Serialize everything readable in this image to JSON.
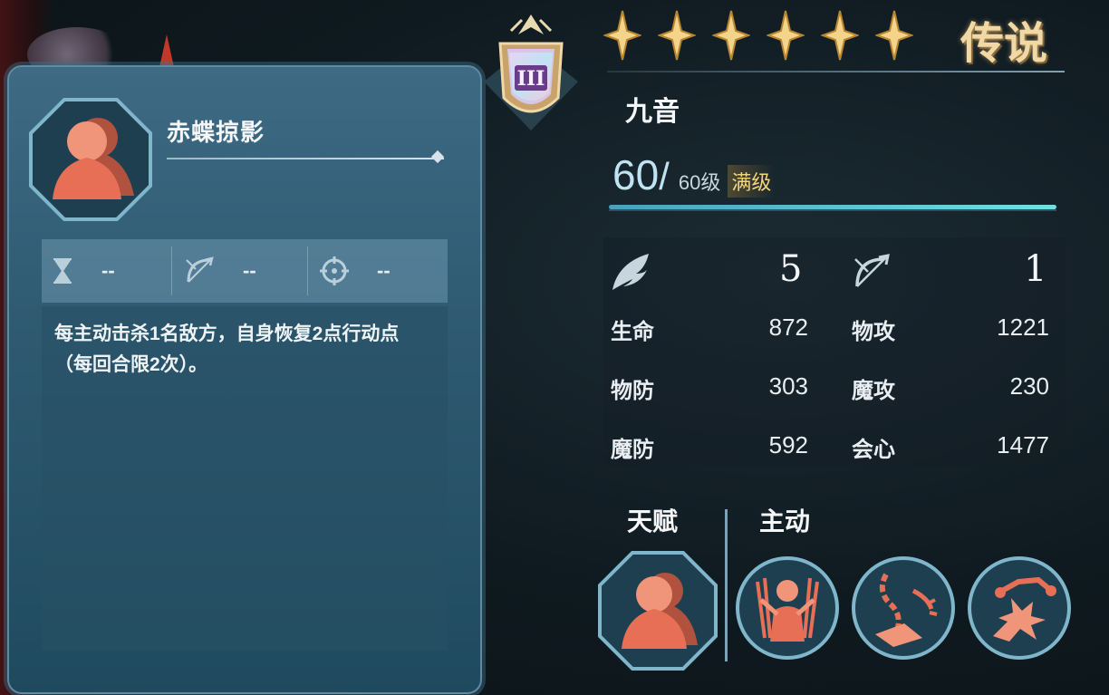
{
  "skill": {
    "name": "赤蝶掠影",
    "attrs": [
      {
        "icon": "hourglass-icon",
        "value": "--"
      },
      {
        "icon": "bow-range-icon",
        "value": "--"
      },
      {
        "icon": "crosshair-icon",
        "value": "--"
      }
    ],
    "description": "每主动击杀1名敌方，自身恢复2点行动点（每回合限2次）。"
  },
  "character": {
    "rank": "III",
    "stars": 6,
    "rarity": "传说",
    "name": "九音",
    "level": "60",
    "slash": "/",
    "max_level": "60级",
    "level_tag": "满级",
    "move": "5",
    "range": "1",
    "stats": [
      {
        "label": "生命",
        "value": "872"
      },
      {
        "label": "物攻",
        "value": "1221"
      },
      {
        "label": "物防",
        "value": "303"
      },
      {
        "label": "魔攻",
        "value": "230"
      },
      {
        "label": "魔防",
        "value": "592"
      },
      {
        "label": "会心",
        "value": "1477"
      }
    ]
  },
  "sections": {
    "talent": "天赋",
    "active": "主动"
  },
  "colors": {
    "panel": "#2f5a72",
    "accent_gold": "#f5d57a",
    "level_bar": "#6fe0e6",
    "skill_orange": "#e0705a"
  }
}
